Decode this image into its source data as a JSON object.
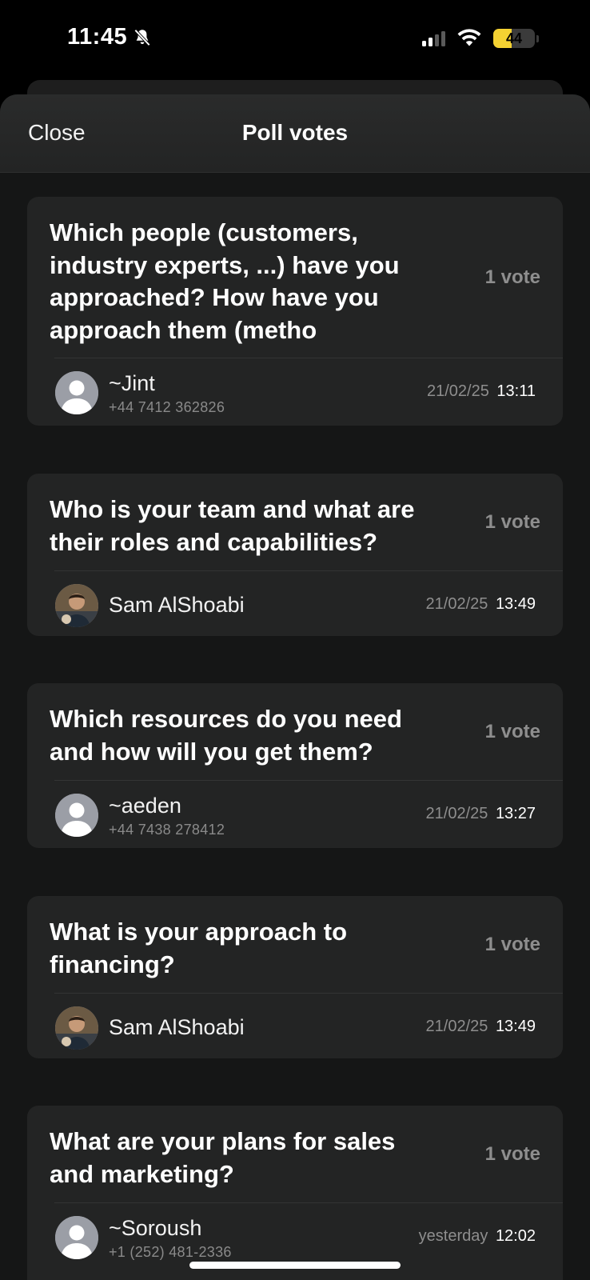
{
  "status_bar": {
    "time": "11:45",
    "battery": "44",
    "battery_percent": 44,
    "battery_color": "#f5d232",
    "icons": [
      "bell-slash-icon",
      "signal-icon",
      "wifi-icon",
      "battery-icon"
    ]
  },
  "header": {
    "close_label": "Close",
    "title": "Poll votes"
  },
  "options": [
    {
      "question": "Which people (customers, industry experts, ...) have you approached? How have you approach them (metho",
      "votes": "1 vote",
      "voter": {
        "name": "~Jint",
        "phone": "+44 7412 362826",
        "date": "21/02/25",
        "time": "13:11",
        "avatar": "default-avatar-icon"
      }
    },
    {
      "question": "Who is your team and what are their roles and capabilities?",
      "votes": "1 vote",
      "voter": {
        "name": "Sam AlShoabi",
        "phone": "",
        "date": "21/02/25",
        "time": "13:49",
        "avatar": "photo-avatar"
      }
    },
    {
      "question": "Which resources do you need and how will you get them?",
      "votes": "1 vote",
      "voter": {
        "name": "~aeden",
        "phone": "+44 7438 278412",
        "date": "21/02/25",
        "time": "13:27",
        "avatar": "default-avatar-icon"
      }
    },
    {
      "question": "What is your approach to financing?",
      "votes": "1 vote",
      "voter": {
        "name": "Sam AlShoabi",
        "phone": "",
        "date": "21/02/25",
        "time": "13:49",
        "avatar": "photo-avatar"
      }
    },
    {
      "question": "What are your plans for sales and marketing?",
      "votes": "1 vote",
      "voter": {
        "name": "~Soroush",
        "phone": "+1 (252) 481-2336",
        "date": "yesterday",
        "time": "12:02",
        "avatar": "default-avatar-icon"
      }
    }
  ]
}
